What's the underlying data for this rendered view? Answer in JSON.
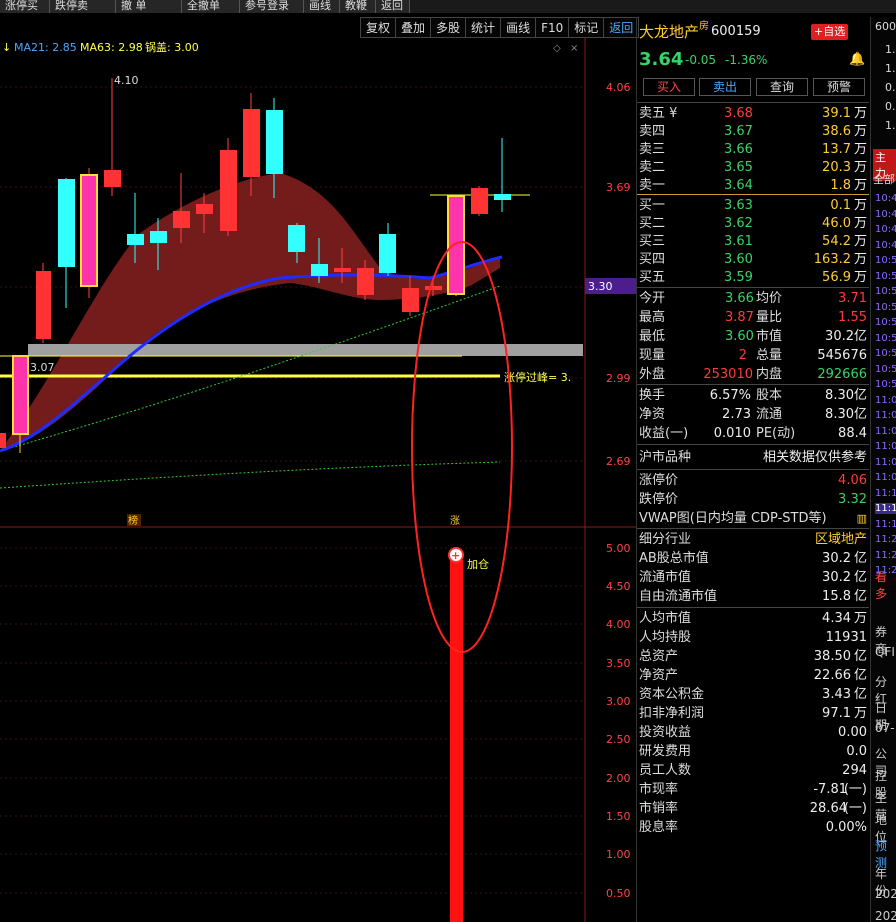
{
  "toolbar": [
    "涨停买",
    "跌停卖",
    "撤 单",
    "全撤单",
    "参号登录",
    "画线",
    "教鞭",
    "返回"
  ],
  "chart_toolbar": [
    "复权",
    "叠加",
    "多股",
    "统计",
    "画线",
    "F10",
    "标记",
    "返回"
  ],
  "chart": {
    "ma_legend": [
      {
        "label": "MA21: 2.85",
        "color": "#4da6ff"
      },
      {
        "label": "MA63: 2.98",
        "color": "#ffff55"
      },
      {
        "label": "锅盖: 3.00",
        "color": "#ffff55"
      }
    ],
    "price_labels": [
      "4.06",
      "3.69",
      "3.30",
      "2.99",
      "2.69"
    ],
    "current_price_tag": "3.30",
    "high_mark": "4.10",
    "line_label": "3.07",
    "limit_label": "涨停过峰= 3.",
    "markers": [
      "榜",
      "涨"
    ],
    "sub_labels": [
      "5.00",
      "4.50",
      "4.00",
      "3.50",
      "3.00",
      "2.50",
      "2.00",
      "1.50",
      "1.00",
      "0.50"
    ],
    "signal_label": "加仓"
  },
  "stock": {
    "name": "大龙地产",
    "name_badge": "房",
    "code": "600159",
    "add_fav": "+自选",
    "price": "3.64",
    "change": "-0.05",
    "change_pct": "-1.36%",
    "buttons": [
      "买入",
      "卖出",
      "查询",
      "预警"
    ]
  },
  "order_book": {
    "sell": [
      {
        "label": "卖五 ¥",
        "price": "3.68",
        "vol": "39.1",
        "unit": "万"
      },
      {
        "label": "卖四",
        "price": "3.67",
        "vol": "38.6",
        "unit": "万"
      },
      {
        "label": "卖三",
        "price": "3.66",
        "vol": "13.7",
        "unit": "万"
      },
      {
        "label": "卖二",
        "price": "3.65",
        "vol": "20.3",
        "unit": "万"
      },
      {
        "label": "卖一",
        "price": "3.64",
        "vol": "1.8",
        "unit": "万"
      }
    ],
    "buy": [
      {
        "label": "买一",
        "price": "3.63",
        "vol": "0.1",
        "unit": "万"
      },
      {
        "label": "买二",
        "price": "3.62",
        "vol": "46.0",
        "unit": "万"
      },
      {
        "label": "买三",
        "price": "3.61",
        "vol": "54.2",
        "unit": "万"
      },
      {
        "label": "买四",
        "price": "3.60",
        "vol": "163.2",
        "unit": "万"
      },
      {
        "label": "买五",
        "price": "3.59",
        "vol": "56.9",
        "unit": "万"
      }
    ]
  },
  "quote": [
    {
      "l1": "今开",
      "v1": "3.66",
      "c1": "grn",
      "l2": "均价",
      "v2": "3.71",
      "c2": "red"
    },
    {
      "l1": "最高",
      "v1": "3.87",
      "c1": "red",
      "l2": "量比",
      "v2": "1.55",
      "c2": "red"
    },
    {
      "l1": "最低",
      "v1": "3.60",
      "c1": "grn",
      "l2": "市值",
      "v2": "30.2亿",
      "c2": "wht"
    },
    {
      "l1": "现量",
      "v1": "2",
      "c1": "red",
      "l2": "总量",
      "v2": "545676",
      "c2": "wht"
    },
    {
      "l1": "外盘",
      "v1": "253010",
      "c1": "red",
      "l2": "内盘",
      "v2": "292666",
      "c2": "grn"
    }
  ],
  "stats": [
    {
      "l1": "换手",
      "v1": "6.57%",
      "l2": "股本",
      "v2": "8.30亿"
    },
    {
      "l1": "净资",
      "v1": "2.73",
      "l2": "流通",
      "v2": "8.30亿"
    },
    {
      "l1": "收益(一)",
      "v1": "0.010",
      "l2": "PE(动)",
      "v2": "88.4"
    }
  ],
  "market_section": {
    "title": "沪市品种",
    "note": "相关数据仅供参考"
  },
  "limits": [
    {
      "label": "涨停价",
      "value": "4.06",
      "color": "red"
    },
    {
      "label": "跌停价",
      "value": "3.32",
      "color": "grn"
    }
  ],
  "vwap_label": "VWAP图(日内均量 CDP-STD等)",
  "industry": {
    "label": "细分行业",
    "value": "区域地产"
  },
  "caps": [
    {
      "label": "AB股总市值",
      "value": "30.2",
      "unit": "亿"
    },
    {
      "label": "流通市值",
      "value": "30.2",
      "unit": "亿"
    },
    {
      "label": "自由流通市值",
      "value": "15.8",
      "unit": "亿"
    }
  ],
  "fundamentals": [
    {
      "label": "人均市值",
      "value": "4.34",
      "unit": "万"
    },
    {
      "label": "人均持股",
      "value": "11931",
      "unit": ""
    },
    {
      "label": "总资产",
      "value": "38.50",
      "unit": "亿"
    },
    {
      "label": "净资产",
      "value": "22.66",
      "unit": "亿"
    },
    {
      "label": "资本公积金",
      "value": "3.43",
      "unit": "亿"
    },
    {
      "label": "扣非净利润",
      "value": "97.1",
      "unit": "万"
    },
    {
      "label": "投资收益",
      "value": "0.00",
      "unit": ""
    },
    {
      "label": "研发费用",
      "value": "0.0",
      "unit": ""
    },
    {
      "label": "员工人数",
      "value": "294",
      "unit": ""
    },
    {
      "label": "市现率",
      "value": "-7.81",
      "unit": "(一)"
    },
    {
      "label": "市销率",
      "value": "28.64",
      "unit": "(一)"
    },
    {
      "label": "股息率",
      "value": "0.00%",
      "unit": ""
    }
  ],
  "far_right": {
    "code_partial": "600",
    "top_vals": [
      "1.",
      "1.",
      "0.",
      "0.",
      "1."
    ],
    "badge": "主力",
    "tab": "全部",
    "times": [
      "10:4",
      "10:4",
      "10:4",
      "10:4",
      "10:5",
      "10:5",
      "10:5",
      "10:5",
      "10:5",
      "10:5",
      "10:5",
      "10:5",
      "10:5",
      "11:0",
      "11:0",
      "11:0",
      "11:0",
      "11:0",
      "11:0",
      "11:1",
      "11:1",
      "11:1",
      "11:2",
      "11:2",
      "11:2"
    ],
    "bottom_texts": [
      "看多",
      "券商",
      "QFI",
      "分红",
      "日期",
      "07-",
      "公司",
      "控股",
      "主营",
      "地位",
      "预测",
      "年份",
      "202",
      "202"
    ]
  }
}
